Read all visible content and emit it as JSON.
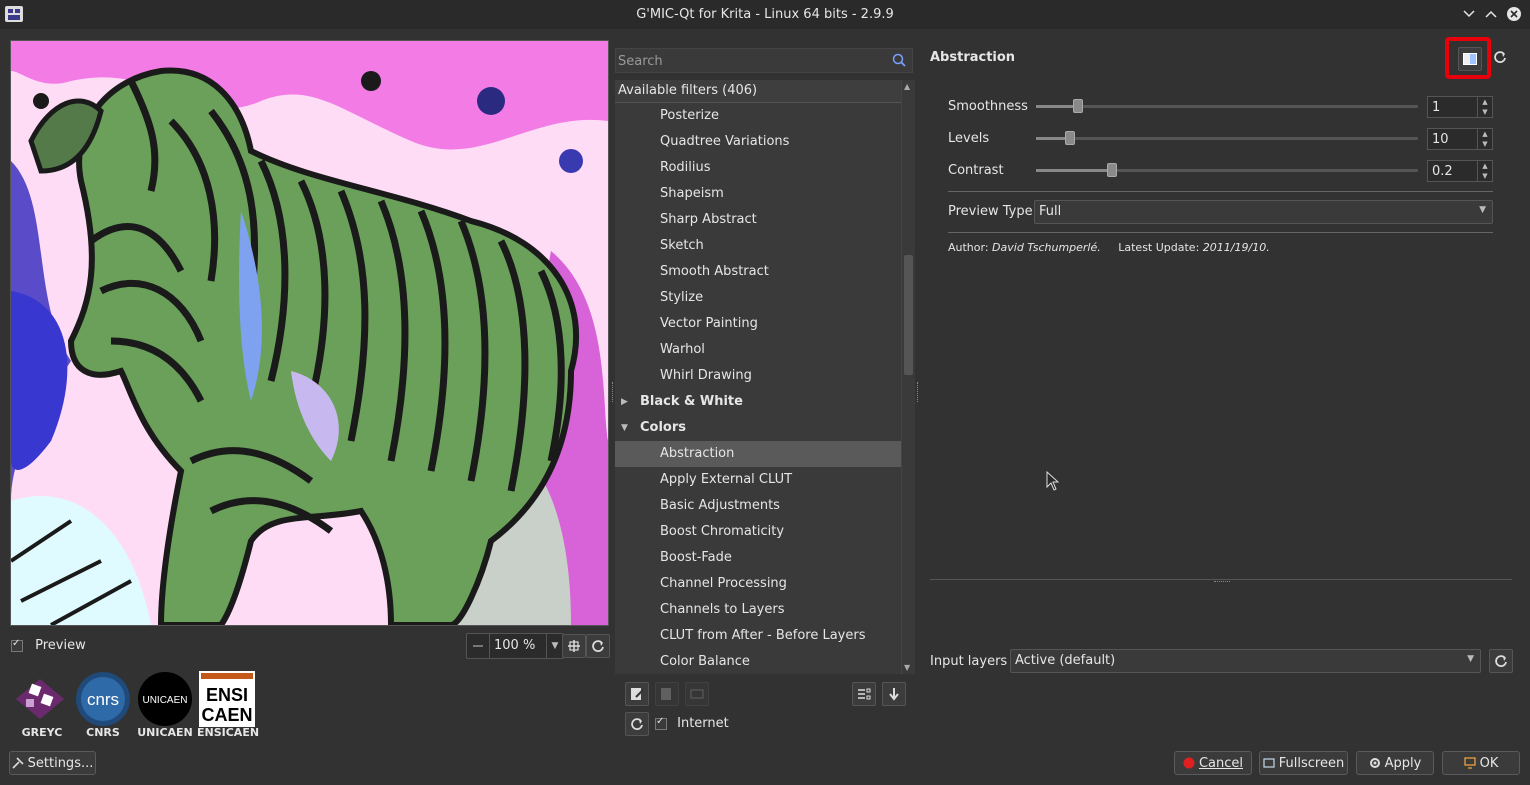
{
  "window": {
    "title": "G'MIC-Qt for Krita - Linux 64 bits - 2.9.9",
    "controls": [
      "chevron-down-icon",
      "chevron-up-icon",
      "close-icon"
    ]
  },
  "preview": {
    "checkbox_label": "Preview",
    "checked": true,
    "zoom_value": "100 %"
  },
  "logos": [
    {
      "name": "GREYC"
    },
    {
      "name": "CNRS"
    },
    {
      "name": "UNICAEN",
      "text": "UNICAEN"
    },
    {
      "name": "ENSICAEN",
      "line1": "ENSI",
      "line2": "CAEN"
    }
  ],
  "settings_button": "Settings...",
  "search": {
    "placeholder": "Search"
  },
  "tree": {
    "header": "Available filters (406)",
    "items_before": [
      "Posterize",
      "Quadtree Variations",
      "Rodilius",
      "Shapeism",
      "Sharp Abstract",
      "Sketch",
      "Smooth Abstract",
      "Stylize",
      "Vector Painting",
      "Warhol",
      "Whirl Drawing"
    ],
    "categories": [
      {
        "label": "Black & White",
        "expanded": false
      },
      {
        "label": "Colors",
        "expanded": true
      }
    ],
    "items_after": [
      "Abstraction",
      "Apply External CLUT",
      "Basic Adjustments",
      "Boost Chromaticity",
      "Boost-Fade",
      "Channel Processing",
      "Channels to Layers",
      "CLUT from After - Before Layers",
      "Color Balance"
    ],
    "selected": "Abstraction"
  },
  "internet": {
    "label": "Internet",
    "checked": true
  },
  "filter": {
    "name": "Abstraction",
    "params": [
      {
        "label": "Smoothness",
        "value": "1",
        "fraction": 0.11
      },
      {
        "label": "Levels",
        "value": "10",
        "fraction": 0.09
      },
      {
        "label": "Contrast",
        "value": "0.2",
        "fraction": 0.2
      }
    ],
    "preview_type_label": "Preview Type",
    "preview_type_value": "Full",
    "author_label": "Author:",
    "author": "David Tschumperlé.",
    "update_label": "Latest Update:",
    "update": "2011/19/10."
  },
  "input_layers": {
    "label": "Input layers",
    "value": "Active (default)"
  },
  "footer": {
    "cancel": "Cancel",
    "fullscreen": "Fullscreen",
    "apply": "Apply",
    "ok": "OK"
  },
  "colors": {
    "highlight": "#e8000b",
    "cancel_icon": "#e02020"
  }
}
